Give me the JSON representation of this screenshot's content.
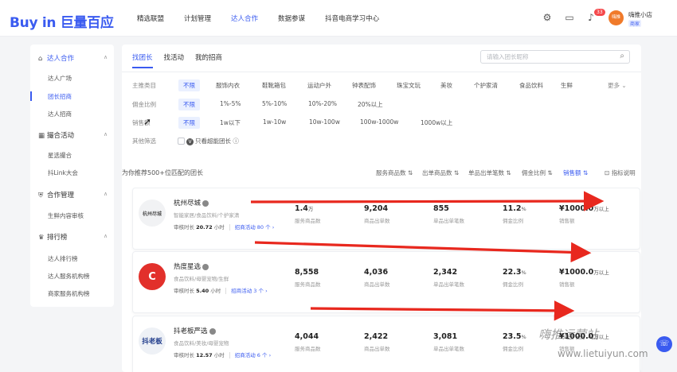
{
  "header": {
    "logo": "Buy in 巨量百应",
    "nav": [
      "精选联盟",
      "计划管理",
      "达人合作",
      "数据参谋",
      "抖音电商学习中心"
    ],
    "nav_active": 2,
    "notification_count": "33",
    "user_avatar": "嗨推",
    "user_name": "嗨推小店",
    "user_tag": "商家"
  },
  "sidebar": {
    "sections": [
      {
        "label": "达人合作",
        "items": [
          "达人广场",
          "团长招商",
          "达人招商"
        ]
      },
      {
        "label": "撮合活动",
        "items": [
          "星选撮合",
          "抖Link大会"
        ]
      },
      {
        "label": "合作管理",
        "items": [
          "生鲜内容审核"
        ]
      },
      {
        "label": "排行榜",
        "items": [
          "达人排行榜",
          "达人服务机构榜",
          "商家服务机构榜"
        ]
      }
    ],
    "active_item": "团长招商"
  },
  "tabs": [
    "找团长",
    "找活动",
    "我的招商"
  ],
  "search": {
    "placeholder": "请输入团长昵称"
  },
  "filters": [
    {
      "label": "主推类目",
      "options": [
        "不限",
        "服饰内衣",
        "鞋靴箱包",
        "运动户外",
        "钟表配饰",
        "珠宝文玩",
        "美妆",
        "个护家清",
        "食品饮料",
        "生鲜"
      ],
      "more": "更多"
    },
    {
      "label": "佣金比例",
      "options": [
        "不限",
        "1%-5%",
        "5%-10%",
        "10%-20%",
        "20%以上"
      ]
    },
    {
      "label": "销售额",
      "options": [
        "不限",
        "1w以下",
        "1w-10w",
        "10w-100w",
        "100w-1000w",
        "1000w以上"
      ]
    },
    {
      "label": "其他筛选",
      "check": "只看超能团长"
    }
  ],
  "recommend_title": "为你推荐500+位匹配的团长",
  "sort_options": [
    "服务商品数",
    "出单商品数",
    "单品出单笔数",
    "佣金比例",
    "销售额",
    "指标说明"
  ],
  "metric_labels": [
    "服务商品数",
    "商品出单数",
    "单品出单笔数",
    "佣金比例",
    "销售额"
  ],
  "leaders": [
    {
      "logo": "杭州尽城",
      "name": "杭州尽城",
      "cats": "智能家居/食品饮料/个护家清",
      "audit_label": "审核时长",
      "audit_value": "20.72",
      "audit_unit": "小时",
      "activity": "招商活动 80 个",
      "metrics": [
        {
          "value": "1.4",
          "suffix": "万"
        },
        {
          "value": "9,204",
          "suffix": ""
        },
        {
          "value": "855",
          "suffix": ""
        },
        {
          "value": "11.2",
          "suffix": "%"
        },
        {
          "value": "¥1000.0",
          "suffix": "万以上"
        }
      ]
    },
    {
      "logo": "C",
      "name": "热度星选",
      "cats": "食品饮料/母婴宠物/生鲜",
      "audit_label": "审核时长",
      "audit_value": "5.40",
      "audit_unit": "小时",
      "activity": "招商活动 3 个",
      "metrics": [
        {
          "value": "8,558",
          "suffix": ""
        },
        {
          "value": "4,036",
          "suffix": ""
        },
        {
          "value": "2,342",
          "suffix": ""
        },
        {
          "value": "22.3",
          "suffix": "%"
        },
        {
          "value": "¥1000.0",
          "suffix": "万以上"
        }
      ]
    },
    {
      "logo": "抖老板",
      "name": "抖老板严选",
      "cats": "食品饮料/美妆/母婴宠物",
      "audit_label": "审核时长",
      "audit_value": "12.57",
      "audit_unit": "小时",
      "activity": "招商活动 6 个",
      "metrics": [
        {
          "value": "4,044",
          "suffix": ""
        },
        {
          "value": "2,422",
          "suffix": ""
        },
        {
          "value": "3,081",
          "suffix": ""
        },
        {
          "value": "23.5",
          "suffix": "%"
        },
        {
          "value": "¥1000.0",
          "suffix": "万以上"
        }
      ]
    }
  ],
  "watermark": "嗨推运营站",
  "watermark_url": "www.lietuiyun.com",
  "colors": {
    "accent": "#3a5bf0",
    "arrow": "#e8281e",
    "badge": "#f5484b"
  }
}
